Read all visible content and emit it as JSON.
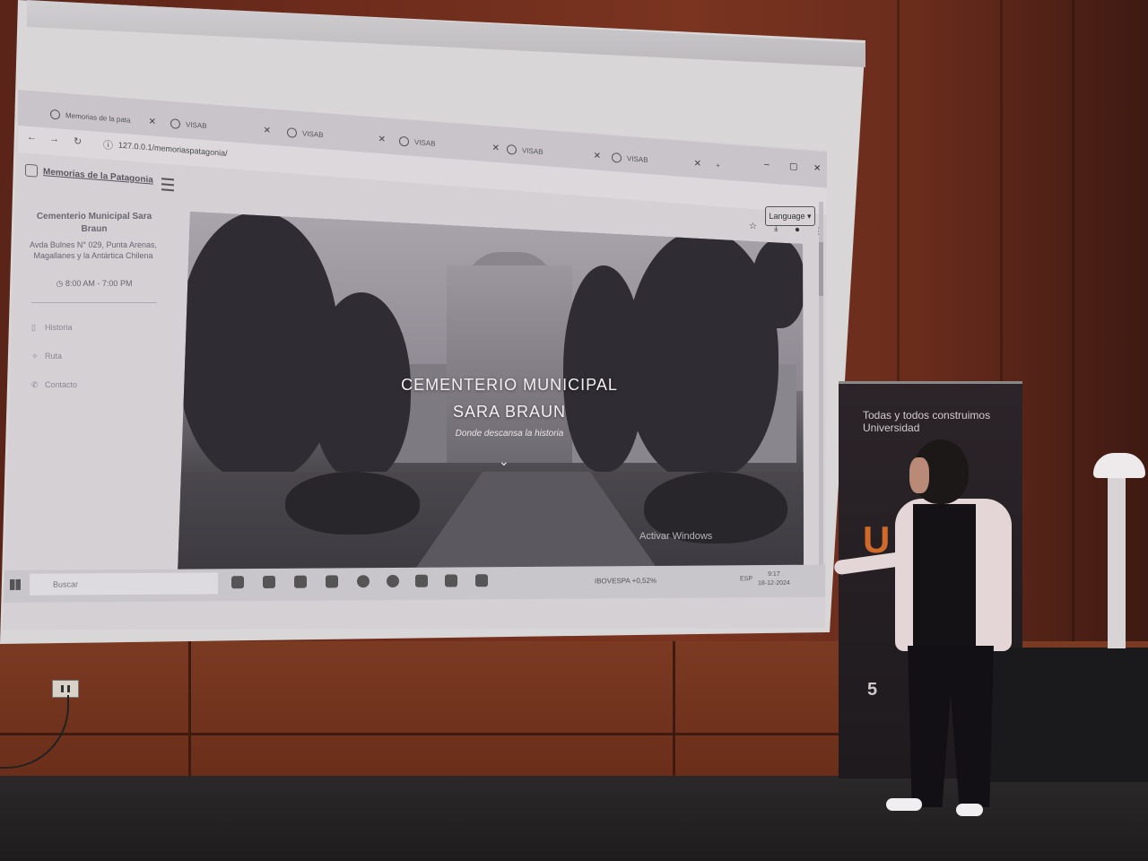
{
  "browser": {
    "tabs": [
      {
        "label": "Memorias de la pata"
      },
      {
        "label": "VISAB"
      },
      {
        "label": "VISAB"
      },
      {
        "label": "VISAB"
      },
      {
        "label": "VISAB"
      },
      {
        "label": "VISAB"
      }
    ],
    "new_tab": "+",
    "url": "127.0.0.1/memoriaspatagonia/"
  },
  "site": {
    "brand": "Memorias de la Patagonia",
    "language_button": "Language"
  },
  "sidebar": {
    "title": "Cementerio Municipal Sara Braun",
    "address": "Avda Bulnes N° 029, Punta Arenas, Magallanes y la Antártica Chilena",
    "hours": "8:00 AM - 7:00 PM",
    "links": [
      {
        "label": "Historia",
        "icon": "book-icon"
      },
      {
        "label": "Ruta",
        "icon": "map-pin-icon"
      },
      {
        "label": "Contacto",
        "icon": "phone-icon"
      }
    ]
  },
  "hero": {
    "title_line1": "CEMENTERIO MUNICIPAL",
    "title_line2": "SARA BRAUN",
    "subtitle": "Donde descansa la historia",
    "chevron": "⌄"
  },
  "windows_watermark": {
    "title": "Activar Windows"
  },
  "taskbar": {
    "search_placeholder": "Buscar",
    "stock_ticker": "IBOVESPA",
    "stock_change": "+0,52%",
    "keyboard_lang": "ESP",
    "time": "9:17",
    "date": "18-12-2024"
  },
  "banner": {
    "slogan": "Todas y todos construimos Universidad",
    "logo_text": "U",
    "bottom_text": "5"
  },
  "colors": {
    "wall": "#6e2c1c",
    "screen": "#d4d0d4",
    "banner": "#1e1a1e",
    "banner_accent": "#d06a2a"
  }
}
